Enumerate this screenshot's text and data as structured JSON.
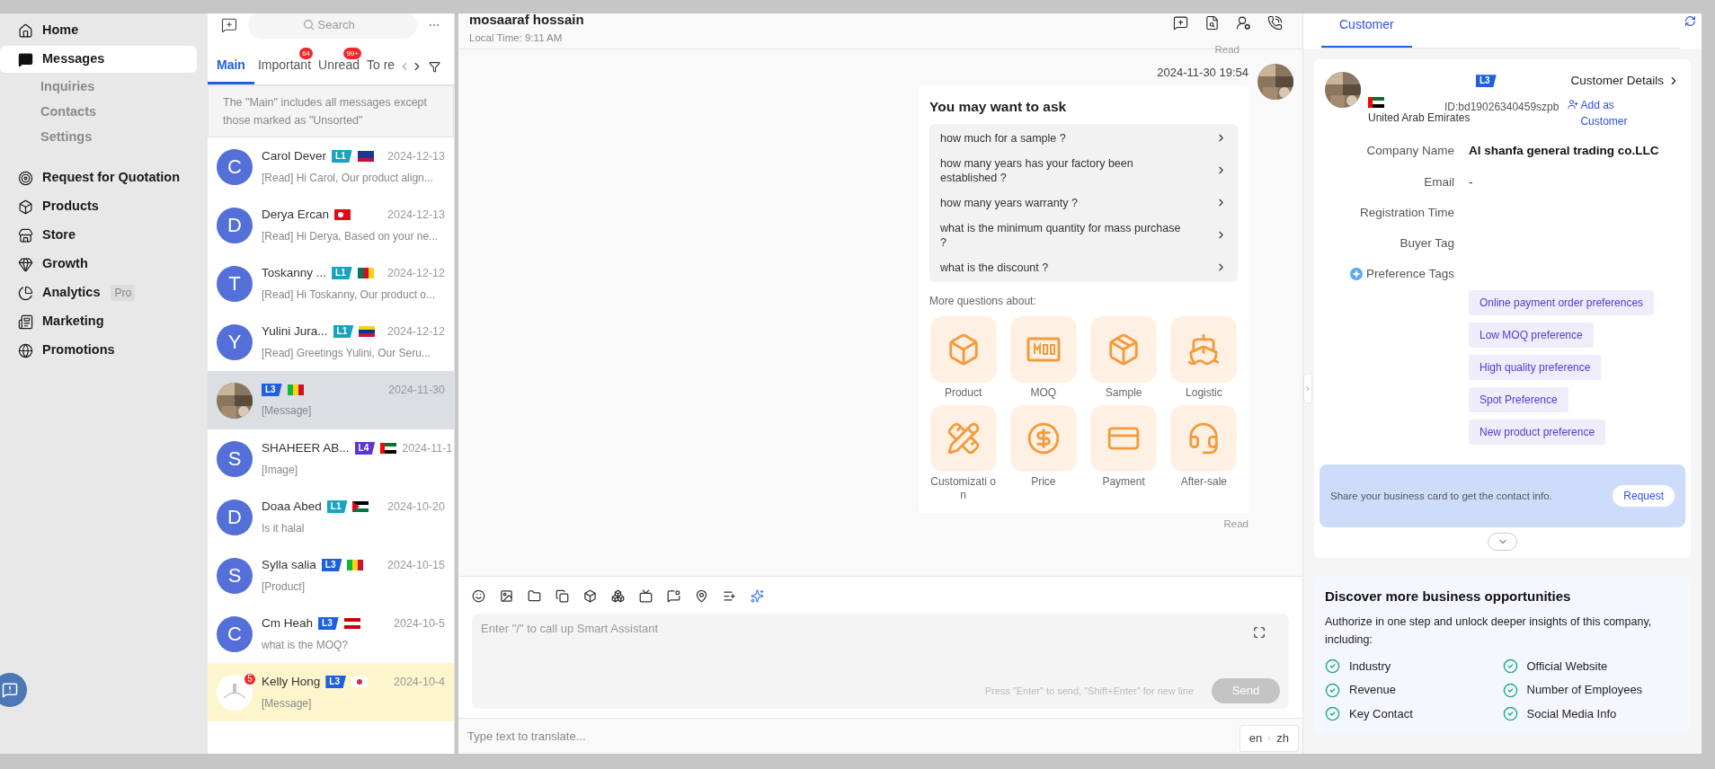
{
  "sidebar": {
    "items": [
      {
        "label": "Home",
        "selected": false
      },
      {
        "label": "Messages",
        "selected": true,
        "children": [
          {
            "label": "Inquiries",
            "selected": false
          },
          {
            "label": "Contacts",
            "selected": false
          },
          {
            "label": "Settings",
            "selected": false
          }
        ]
      },
      {
        "label": "Request for Quotation",
        "selected": false
      },
      {
        "label": "Products",
        "selected": false
      },
      {
        "label": "Store",
        "selected": false
      },
      {
        "label": "Growth",
        "selected": false
      },
      {
        "label": "Analytics",
        "selected": false,
        "badge": "Pro"
      },
      {
        "label": "Marketing",
        "selected": false
      },
      {
        "label": "Promotions",
        "selected": false
      }
    ]
  },
  "conversation_list": {
    "search": {
      "placeholder": "Search"
    },
    "tabs": [
      {
        "label": "Main",
        "selected": true
      },
      {
        "label": "Important",
        "selected": false,
        "badge": "64"
      },
      {
        "label": "Unread",
        "selected": false,
        "badge": "99+"
      },
      {
        "label": "To re",
        "selected": false
      }
    ],
    "notice": "The \"Main\" includes all messages except those marked as \"Unsorted\"",
    "conversations": [
      {
        "initial": "C",
        "name": "Carol Dever",
        "level": "L1",
        "color": "#1aa3c0",
        "date": "2024-12-13",
        "preview": "[Read] Hi Carol, Our product align...",
        "selected": false,
        "pinned": false
      },
      {
        "initial": "D",
        "name": "Derya Ercan",
        "date": "2024-12-13",
        "preview": "[Read] Hi Derya, Based on your ne...",
        "selected": false,
        "pinned": false
      },
      {
        "initial": "T",
        "name": "Toskanny ...",
        "level": "L1",
        "color": "#1aa3c0",
        "date": "2024-12-12",
        "preview": "[Read] Hi Toskanny, Our product o...",
        "selected": false,
        "pinned": false
      },
      {
        "initial": "Y",
        "name": "Yulini Jura...",
        "level": "L1",
        "color": "#1aa3c0",
        "date": "2024-12-12",
        "preview": "[Read] Greetings Yulini, Our Seru...",
        "selected": false,
        "pinned": false
      },
      {
        "kind": "picture",
        "level": "L3",
        "color": "#1f5fe0",
        "date": "2024-11-30",
        "preview": "[Message]",
        "selected": true,
        "pinned": false
      },
      {
        "initial": "S",
        "name": "SHAHEER AB...",
        "level": "L4",
        "color": "#5b35d5",
        "date": "2024-11-1",
        "preview": "[Image]",
        "selected": false,
        "pinned": false
      },
      {
        "initial": "D",
        "name": "Doaa Abed",
        "level": "L1",
        "color": "#1aa3c0",
        "date": "2024-10-20",
        "preview": "Is it halal",
        "selected": false,
        "pinned": false
      },
      {
        "initial": "S",
        "name": "Sylla salia",
        "level": "L3",
        "color": "#1f5fe0",
        "date": "2024-10-15",
        "preview": "[Product]",
        "selected": false,
        "pinned": false
      },
      {
        "initial": "C",
        "name": "Cm Heah",
        "level": "L3",
        "color": "#1f5fe0",
        "date": "2024-10-5",
        "preview": "what is the MOQ?",
        "selected": false,
        "pinned": false
      },
      {
        "kind": "picture",
        "name": "Kelly Hong",
        "level": "L3",
        "color": "#1f5fe0",
        "date": "2024-10-4",
        "preview": "[Message]",
        "selected": false,
        "pinned": true,
        "badge": "5"
      }
    ]
  },
  "chat": {
    "contact_name": "mosaaraf hossain",
    "local_time": "Local Time: 9:11 AM",
    "top_status": "Read",
    "timestamp": "2024-11-30 19:54",
    "card": {
      "title": "You may want to ask",
      "questions": [
        "how much for a sample ?",
        "how many years has your factory been established ?",
        "how many years warranty ?",
        "what is the minimum quantity for mass purchase ?",
        "what is the discount ?"
      ],
      "more_label": "More questions about:",
      "topics": [
        "Product",
        "MOQ",
        "Sample",
        "Logistic",
        "Customizati on",
        "Price",
        "Payment",
        "After-sale"
      ]
    },
    "bottom_status": "Read",
    "composer": {
      "placeholder": "Enter \"/\" to call up Smart Assistant",
      "hint": "Press \"Enter\" to send, \"Shift+Enter\" for new line",
      "send_label": "Send",
      "send_disabled": true
    },
    "translate": {
      "placeholder": "Type text to translate...",
      "source_lang": "en",
      "target_lang": "zh"
    }
  },
  "customer_panel": {
    "tabs": [
      {
        "label": "Customer",
        "selected": true
      }
    ],
    "level": "L3",
    "details_link": "Customer Details",
    "country": "United Arab Emirates",
    "customer_id": "ID:bd19026340459szpb",
    "add_link": "Add as Customer",
    "fields": [
      {
        "label": "Company Name",
        "value": "Al shanfa general trading co.LLC"
      },
      {
        "label": "Email",
        "value": "-"
      },
      {
        "label": "Registration Time"
      },
      {
        "label": "Buyer Tag"
      }
    ],
    "preference_label": "Preference Tags",
    "preference_tags": [
      "Online payment order preferences",
      "Low MOQ preference",
      "High quality preference",
      "Spot Preference",
      "New product preference"
    ],
    "share_text": "Share your business card to get the contact info.",
    "request_label": "Request",
    "discover": {
      "title": "Discover more business opportunities",
      "description": "Authorize in one step and unlock deeper insights of this company, including:",
      "items": [
        "Industry",
        "Official Website",
        "Revenue",
        "Number of Employees",
        "Key Contact",
        "Social Media Info"
      ]
    }
  }
}
